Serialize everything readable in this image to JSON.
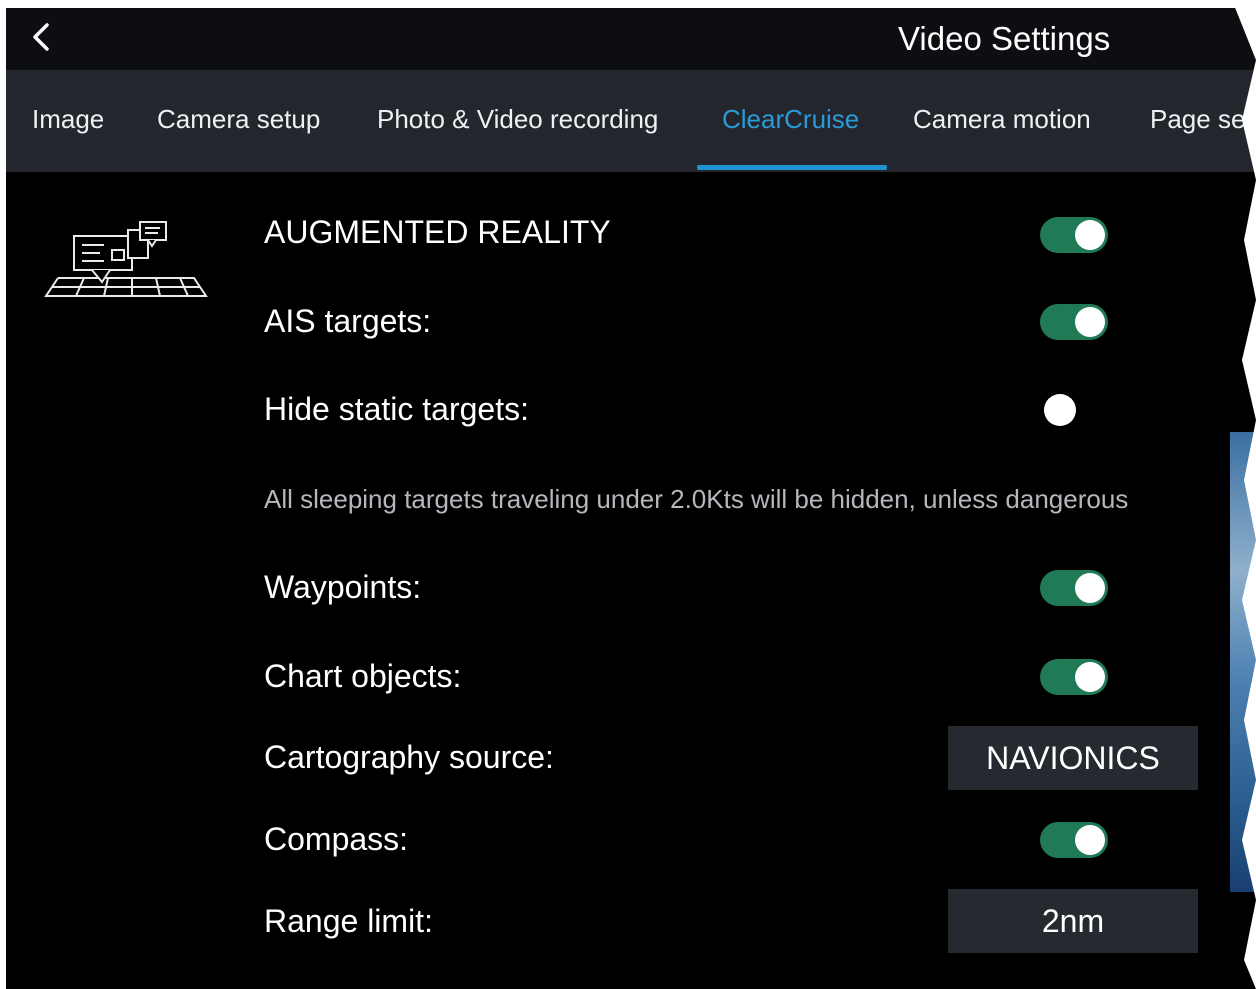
{
  "header": {
    "back_icon": "chevron-left-icon",
    "title": "Video Settings"
  },
  "tabs": [
    {
      "label": "Image",
      "active": false
    },
    {
      "label": "Camera setup",
      "active": false
    },
    {
      "label": "Photo & Video recording",
      "active": false
    },
    {
      "label": "ClearCruise",
      "active": true
    },
    {
      "label": "Camera motion",
      "active": false
    },
    {
      "label": "Page se",
      "active": false
    }
  ],
  "settings": {
    "augmented_reality": {
      "label": "AUGMENTED REALITY",
      "on": true
    },
    "ais_targets": {
      "label": "AIS targets:",
      "on": true
    },
    "hide_static_targets": {
      "label": "Hide static targets:",
      "on": false
    },
    "hide_static_hint": "All sleeping targets traveling under 2.0Kts will be hidden, unless dangerous",
    "waypoints": {
      "label": "Waypoints:",
      "on": true
    },
    "chart_objects": {
      "label": "Chart objects:",
      "on": true
    },
    "cartography_source": {
      "label": "Cartography source:",
      "value": "NAVIONICS"
    },
    "compass": {
      "label": "Compass:",
      "on": true
    },
    "range_limit": {
      "label": "Range limit:",
      "value": "2nm"
    }
  },
  "section_icon": "augmented-reality-icon",
  "colors": {
    "accent": "#2a9bd8",
    "toggle_on": "#1f7a55",
    "tab_bar": "#23272d",
    "background": "#000000"
  }
}
